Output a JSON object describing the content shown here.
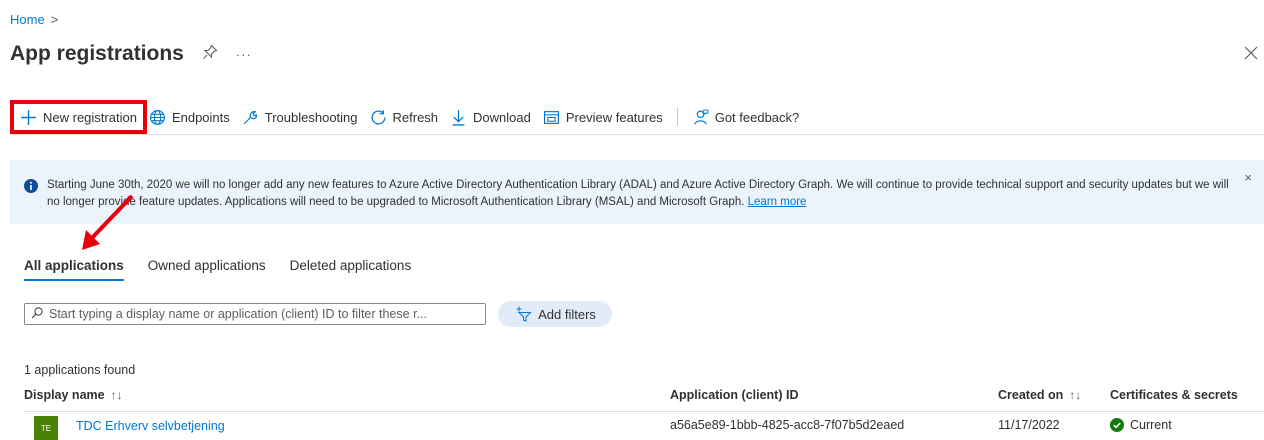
{
  "breadcrumb": {
    "home": "Home",
    "separator": ">"
  },
  "header": {
    "title": "App registrations",
    "more": "···",
    "pin_icon": "pin-icon",
    "close_icon": "close-icon"
  },
  "toolbar": {
    "new_registration": "New registration",
    "endpoints": "Endpoints",
    "troubleshooting": "Troubleshooting",
    "refresh": "Refresh",
    "download": "Download",
    "preview_features": "Preview features",
    "got_feedback": "Got feedback?"
  },
  "banner": {
    "text": "Starting June 30th, 2020 we will no longer add any new features to Azure Active Directory Authentication Library (ADAL) and Azure Active Directory Graph. We will continue to provide technical support and security updates but we will no longer provide feature updates. Applications will need to be upgraded to Microsoft Authentication Library (MSAL) and Microsoft Graph.",
    "learn_more": "Learn more",
    "close": "×"
  },
  "tabs": [
    {
      "label": "All applications",
      "active": true
    },
    {
      "label": "Owned applications",
      "active": false
    },
    {
      "label": "Deleted applications",
      "active": false
    }
  ],
  "search": {
    "placeholder": "Start typing a display name or application (client) ID to filter these r..."
  },
  "filters": {
    "add_filters": "Add filters"
  },
  "results": {
    "count_text": "1 applications found"
  },
  "table": {
    "columns": {
      "display_name": "Display name",
      "client_id": "Application (client) ID",
      "created_on": "Created on",
      "certificates": "Certificates & secrets"
    },
    "sort_icon": "↑↓",
    "rows": [
      {
        "avatar": "TE",
        "display_name": "TDC Erhverv selvbetjening",
        "client_id": "a56a5e89-1bbb-4825-acc8-7f07b5d2eaed",
        "created_on": "11/17/2022",
        "certificates": "Current"
      }
    ]
  },
  "colors": {
    "accent": "#0078d4",
    "highlight": "#e8000b",
    "banner_bg": "#ebf3fc",
    "success": "#107c10",
    "avatar": "#498205"
  }
}
